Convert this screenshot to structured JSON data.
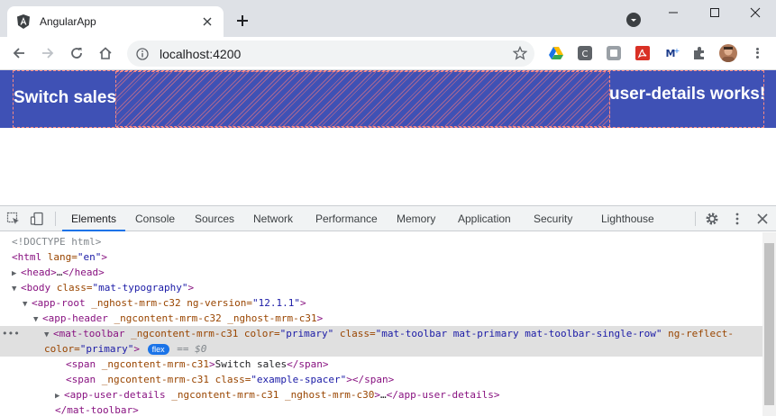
{
  "browser": {
    "tab_title": "AngularApp",
    "url": "localhost:4200",
    "new_tab_label": "+"
  },
  "page": {
    "toolbar_left": "Switch sales",
    "toolbar_right": "user-details works!",
    "colors": {
      "toolbar": "#3f51b5",
      "outline": "#ff8a80"
    }
  },
  "devtools": {
    "tabs": [
      "Elements",
      "Console",
      "Sources",
      "Network",
      "Performance",
      "Memory",
      "Application",
      "Security",
      "Lighthouse"
    ],
    "active_tab": "Elements",
    "dom": {
      "l0": "<!DOCTYPE html>",
      "l1_tag": "<html",
      "l1_attr": " lang=",
      "l1_val": "\"en\"",
      "l1_close": ">",
      "l2_tag": "<head>",
      "l2_dots": "…",
      "l2_close": "</head>",
      "l3_tag": "<body",
      "l3_attr": " class=",
      "l3_val": "\"mat-typography\"",
      "l3_close": ">",
      "l4_tag": "<app-root",
      "l4_attr": " _nghost-mrm-c32 ng-version=",
      "l4_val": "\"12.1.1\"",
      "l4_close": ">",
      "l5_tag": "<app-header",
      "l5_attr": " _ngcontent-mrm-c32 _nghost-mrm-c31",
      "l5_close": ">",
      "l6_tag": "<mat-toolbar",
      "l6_attr1": " _ngcontent-mrm-c31 color=",
      "l6_val1": "\"primary\"",
      "l6_attr2": " class=",
      "l6_val2": "\"mat-toolbar mat-primary mat-toolbar-single-row\"",
      "l6_attr3": " ng-reflect-",
      "l7_attr": "color=",
      "l7_val": "\"primary\"",
      "l7_close": ">",
      "flex_badge": "flex",
      "eq_ref": "== $0",
      "l8_tag": "<span",
      "l8_attr": " _ngcontent-mrm-c31",
      "l8_close": ">",
      "l8_text": "Switch sales",
      "l8_end": "</span>",
      "l9_tag": "<span",
      "l9_attr": " _ngcontent-mrm-c31 class=",
      "l9_val": "\"example-spacer\"",
      "l9_close": "></span>",
      "l10_tag": "<app-user-details",
      "l10_attr": " _ngcontent-mrm-c31 _nghost-mrm-c30",
      "l10_close": ">",
      "l10_dots": "…",
      "l10_end": "</app-user-details>",
      "l11_tag": "</mat-toolbar>"
    }
  }
}
